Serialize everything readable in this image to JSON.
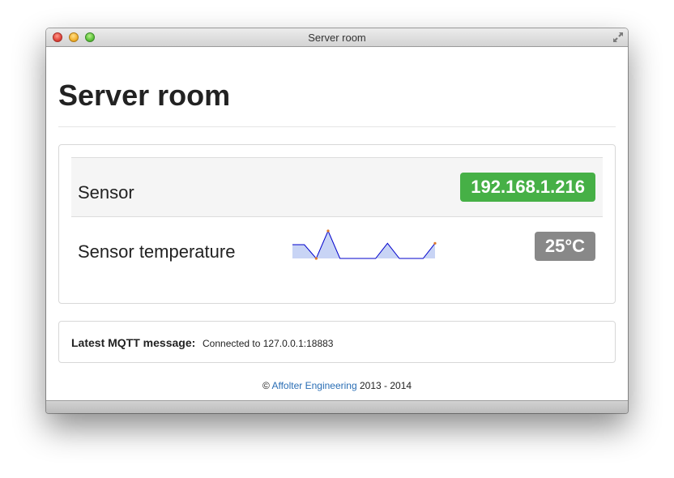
{
  "window": {
    "title": "Server room"
  },
  "page": {
    "heading": "Server room"
  },
  "sensors": {
    "rows": [
      {
        "label": "Sensor",
        "value": "192.168.1.216",
        "color": "#46b046"
      },
      {
        "label": "Sensor temperature",
        "value": "25°C",
        "color": "#888888"
      }
    ],
    "sparkline": {
      "values": [
        0.5,
        0.5,
        0.0,
        1.0,
        0.0,
        0.0,
        0.0,
        0.0,
        0.55,
        0.0,
        0.0,
        0.0,
        0.55
      ],
      "line_color": "#0000cc",
      "fill_color": "#c8d4f5",
      "marker_color": "#e07a2a"
    }
  },
  "mqtt": {
    "label": "Latest MQTT message:",
    "value": "Connected to 127.0.0.1:18883"
  },
  "footer": {
    "copyright_symbol": "©",
    "link_text": "Affolter Engineering",
    "years": "2013 - 2014",
    "link_color": "#2a6eb5"
  }
}
